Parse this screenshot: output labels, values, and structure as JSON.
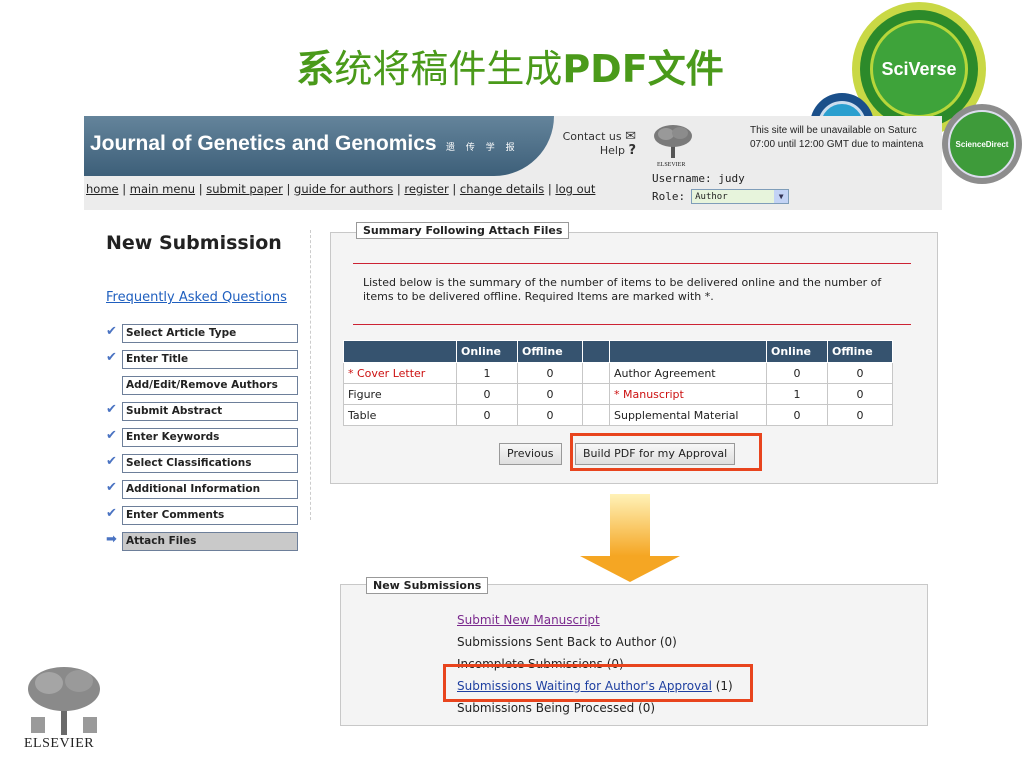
{
  "slide": {
    "title_part1": "系",
    "title_part2": "统将稿件生成",
    "title_part3": "PDF",
    "title_part4": "文件"
  },
  "logos": {
    "sciverse": "SciVerse",
    "sciencedirect": "ScienceDirect",
    "elsevier": "ELSEVIER"
  },
  "header": {
    "journal_title": "Journal of Genetics and Genomics",
    "journal_cn": "遗 传 学 报",
    "contact_label": "Contact us",
    "help_label": "Help",
    "help_symbol": "?",
    "mail_symbol": "✉",
    "elsevier_small": "ELSEVIER",
    "notice_line1": "This site will be unavailable on Saturc",
    "notice_line2": "07:00 until 12:00 GMT due to maintena",
    "username": "Username: judy",
    "role_label": "Role:",
    "role_value": "Author"
  },
  "nav": {
    "home": "home",
    "main_menu": "main menu",
    "submit_paper": "submit paper",
    "guide": "guide for authors",
    "register": "register",
    "change_details": "change details",
    "log_out": "log out",
    "sep": " | "
  },
  "sidebar": {
    "title": "New Submission",
    "faq": "Frequently Asked Questions",
    "steps": [
      {
        "label": "Select Article Type",
        "done": true
      },
      {
        "label": "Enter Title",
        "done": true
      },
      {
        "label": "Add/Edit/Remove Authors",
        "done": false
      },
      {
        "label": "Submit Abstract",
        "done": true
      },
      {
        "label": "Enter Keywords",
        "done": true
      },
      {
        "label": "Select Classifications",
        "done": true
      },
      {
        "label": "Additional Information",
        "done": true
      },
      {
        "label": "Enter Comments",
        "done": true
      },
      {
        "label": "Attach Files",
        "done": false,
        "active": true
      }
    ],
    "check_symbol": "✔",
    "arrow_symbol": "➡"
  },
  "summary": {
    "legend": "Summary Following Attach Files",
    "info": "Listed below is the summary of the number of items to be delivered online and the number of items to be delivered offline. Required Items are marked with *.",
    "headers": [
      "",
      "Online",
      "Offline",
      "",
      "",
      "Online",
      "Offline"
    ],
    "rows": [
      {
        "left": "* Cover Letter",
        "left_req": true,
        "lon": "1",
        "loff": "0",
        "right": "Author Agreement",
        "right_req": false,
        "ron": "0",
        "roff": "0"
      },
      {
        "left": "Figure",
        "left_req": false,
        "lon": "0",
        "loff": "0",
        "right": "* Manuscript",
        "right_req": true,
        "ron": "1",
        "roff": "0"
      },
      {
        "left": "Table",
        "left_req": false,
        "lon": "0",
        "loff": "0",
        "right": "Supplemental Material",
        "right_req": false,
        "ron": "0",
        "roff": "0"
      }
    ],
    "previous_button": "Previous",
    "build_button": "Build PDF for my Approval"
  },
  "new_submissions": {
    "legend": "New Submissions",
    "submit_new": "Submit New Manuscript",
    "sent_back": "Submissions Sent Back to Author (0)",
    "incomplete": "Incomplete Submissions (0)",
    "waiting": "Submissions Waiting for Author's Approval",
    "waiting_count": " (1)",
    "processed": "Submissions Being Processed (0)"
  },
  "colors": {
    "title_green": "#4a9a1a",
    "banner_blue": "#3d5f79",
    "table_header": "#36536f",
    "highlight": "#e8441d",
    "arrow": "#f5a623"
  }
}
